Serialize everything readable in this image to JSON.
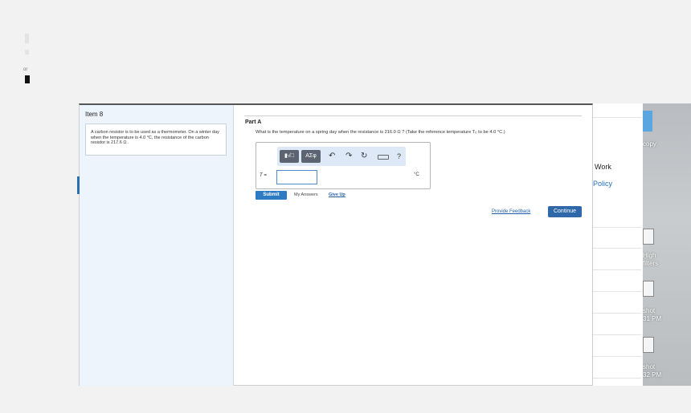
{
  "artifact": {
    "text": "or"
  },
  "item": {
    "title": "Item 8",
    "problem": "A carbon resistor is to be used as a thermometer. On a winter day when the temperature is 4.0 °C, the resistance of the carbon resistor is 217.6 Ω ."
  },
  "part": {
    "label": "Part A",
    "question": "What is the temperature on a spring day when the resistance is 216.0 Ω ? (Take the reference temperature T₀ to be 4.0 °C.)"
  },
  "toolbar": {
    "templates_label": "▮√□",
    "greek_label": "ΑΣφ",
    "undo_icon": "↶",
    "redo_icon": "↷",
    "reset_icon": "↻",
    "help_label": "?"
  },
  "answer": {
    "variable_label": "T =",
    "value": "",
    "unit": "°C"
  },
  "actions": {
    "submit_label": "Submit",
    "my_answers_label": "My Answers",
    "give_up_label": "Give Up",
    "feedback_label": "Provide Feedback",
    "continue_label": "Continue"
  },
  "background_window": {
    "work_label": "Work",
    "policy_label": "Policy"
  },
  "desktop": {
    "label_top": "copy",
    "label_mid_1": "High",
    "label_mid_2": "filters",
    "label_shot1_a": "shot",
    "label_shot1_b": "31 PM",
    "label_shot2_a": "shot",
    "label_shot2_b": "32 PM"
  },
  "colors": {
    "accent": "#2e7bc4",
    "continue": "#2f68a8",
    "link": "#1f5fa8",
    "sidebar": "#eef4fb"
  }
}
